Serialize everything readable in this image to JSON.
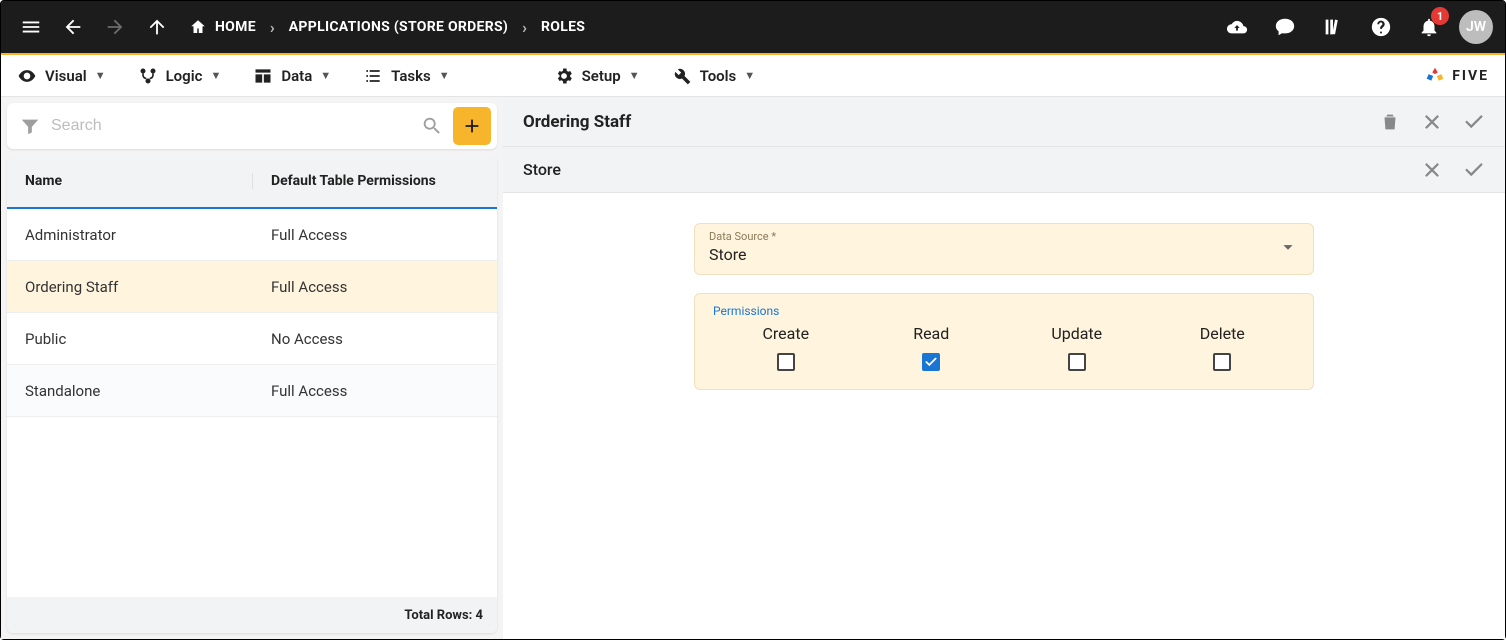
{
  "topbar": {
    "breadcrumb": [
      {
        "icon": "home",
        "label": "HOME"
      },
      {
        "label": "APPLICATIONS (STORE ORDERS)"
      },
      {
        "label": "ROLES"
      }
    ],
    "avatar": "JW",
    "notif_count": "1"
  },
  "menus": [
    {
      "icon": "eye",
      "label": "Visual"
    },
    {
      "icon": "branch",
      "label": "Logic"
    },
    {
      "icon": "table",
      "label": "Data"
    },
    {
      "icon": "list",
      "label": "Tasks"
    },
    {
      "icon": "gear",
      "label": "Setup"
    },
    {
      "icon": "wrench",
      "label": "Tools"
    }
  ],
  "brand": "FIVE",
  "search": {
    "placeholder": "Search"
  },
  "table": {
    "headers": {
      "name": "Name",
      "perm": "Default Table Permissions"
    },
    "rows": [
      {
        "name": "Administrator",
        "perm": "Full Access",
        "selected": false
      },
      {
        "name": "Ordering Staff",
        "perm": "Full Access",
        "selected": true
      },
      {
        "name": "Public",
        "perm": "No Access",
        "selected": false
      },
      {
        "name": "Standalone",
        "perm": "Full Access",
        "selected": false
      }
    ],
    "footer": "Total Rows: 4"
  },
  "detail": {
    "title": "Ordering Staff",
    "subsection": "Store",
    "data_source": {
      "label": "Data Source *",
      "value": "Store"
    },
    "permissions": {
      "label": "Permissions",
      "items": [
        {
          "name": "Create",
          "checked": false
        },
        {
          "name": "Read",
          "checked": true
        },
        {
          "name": "Update",
          "checked": false
        },
        {
          "name": "Delete",
          "checked": false
        }
      ]
    }
  }
}
